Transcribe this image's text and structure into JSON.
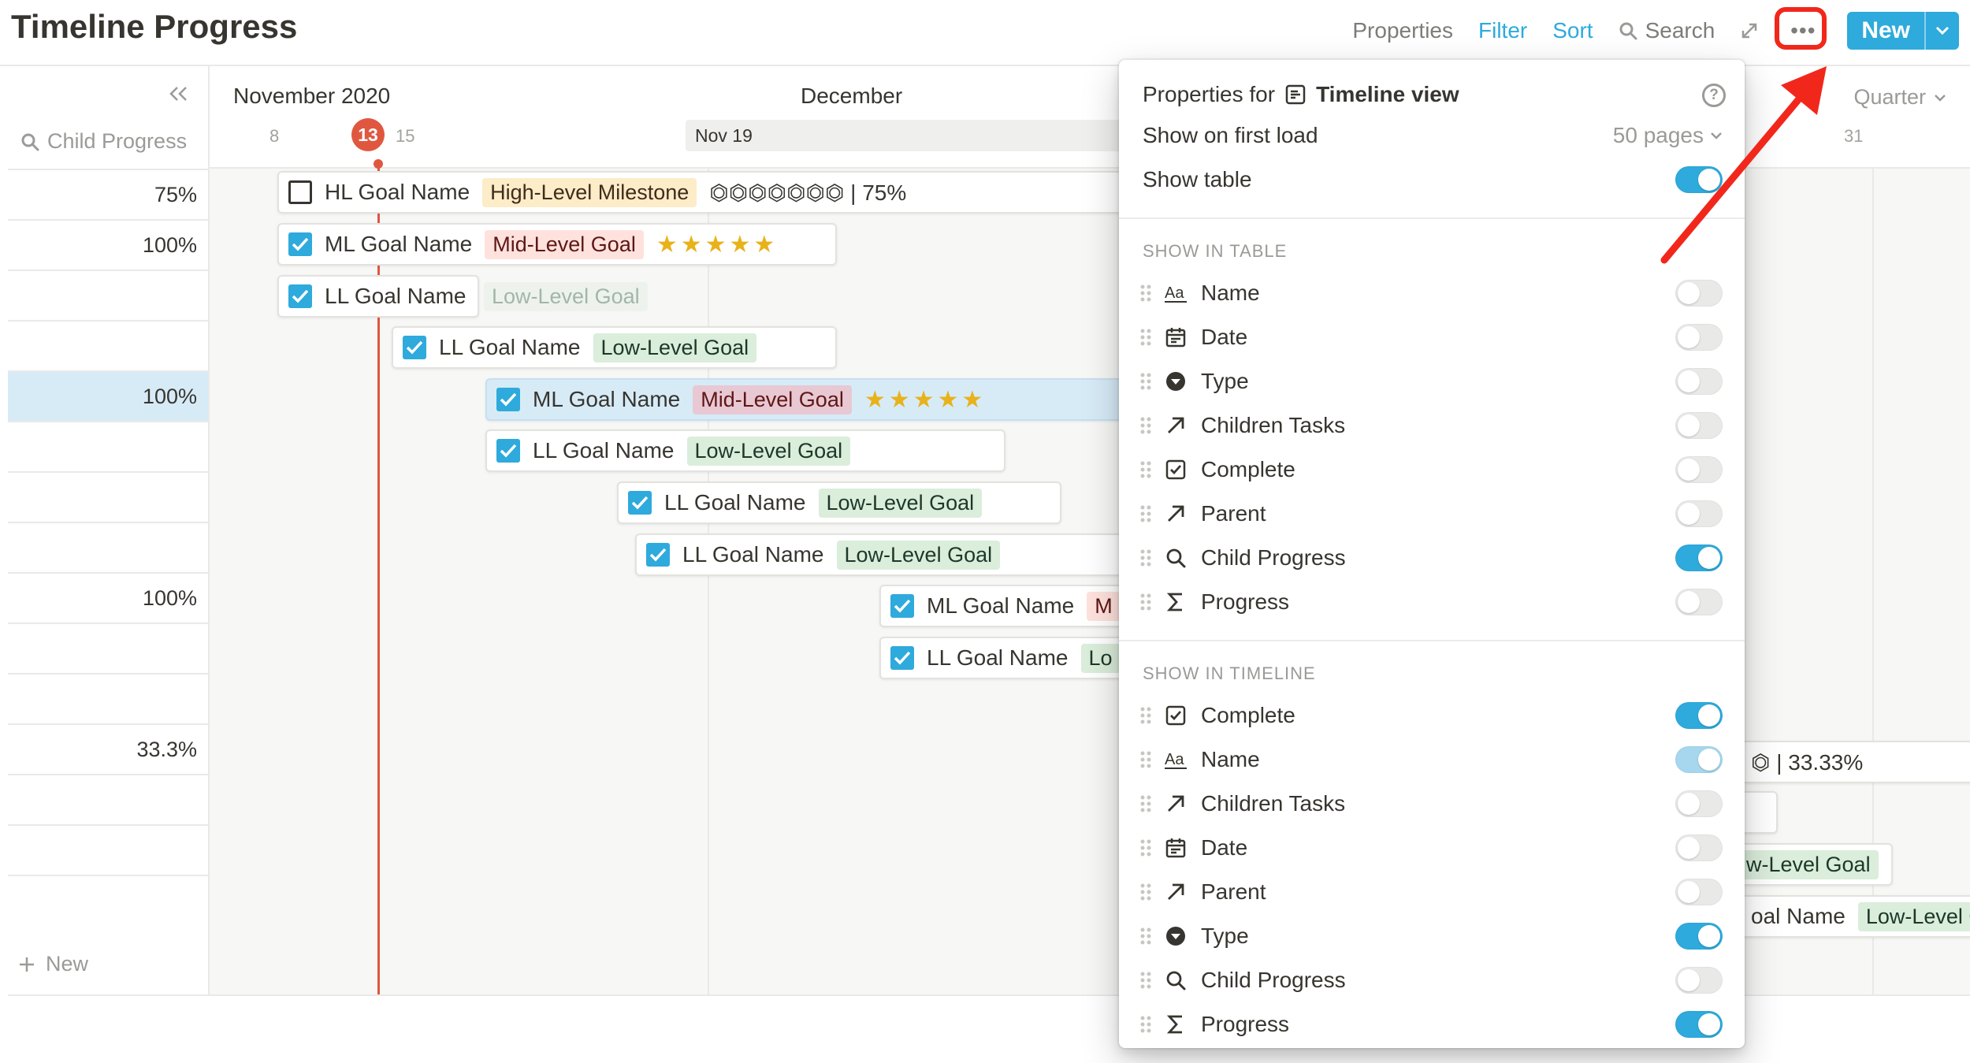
{
  "page": {
    "title": "Timeline Progress"
  },
  "toolbar": {
    "properties": "Properties",
    "filter": "Filter",
    "sort": "Sort",
    "search": "Search",
    "more": "•••",
    "new": "New"
  },
  "left_pane": {
    "column_header": "Child Progress",
    "rows": [
      "75%",
      "100%",
      "",
      "",
      "100%",
      "",
      "",
      "",
      "100%",
      "",
      "",
      "33.3%",
      "",
      "",
      ""
    ],
    "new_label": "New"
  },
  "timeline_header": {
    "month_1": "November 2020",
    "month_2": "December",
    "day_8": "8",
    "today": "13",
    "day_15": "15",
    "day_31": "31",
    "range_label": "Nov 19",
    "zoom": "Quarter"
  },
  "cards": [
    {
      "checked": false,
      "name": "HL Goal Name",
      "tag": "High-Level Milestone",
      "progress": "⏣⏣⏣⏣⏣⏣⏣ | 75%"
    },
    {
      "checked": true,
      "name": "ML Goal Name",
      "tag": "Mid-Level Goal",
      "stars": "★★★★★"
    },
    {
      "checked": true,
      "name": "LL Goal Name",
      "tag": "Low-Level Goal"
    },
    {
      "checked": true,
      "name": "LL Goal Name",
      "tag": "Low-Level Goal"
    },
    {
      "checked": true,
      "name": "ML Goal Name",
      "tag": "Mid-Level Goal",
      "stars": "★★★★★"
    },
    {
      "checked": true,
      "name": "LL Goal Name",
      "tag": "Low-Level Goal"
    },
    {
      "checked": true,
      "name": "LL Goal Name",
      "tag": "Low-Level Goal"
    },
    {
      "checked": true,
      "name": "LL Goal Name",
      "tag": "Low-Level Goal"
    },
    {
      "checked": true,
      "name": "ML Goal Name",
      "tag": "M"
    },
    {
      "checked": true,
      "name": "LL Goal Name",
      "tag": "Lo"
    }
  ],
  "right_peek": {
    "progress": "⏣ | 33.33%",
    "tag_fragment": "w-Level Goal",
    "name_fragment": "oal Name",
    "tag_fragment_2": "Low-Level G"
  },
  "properties_panel": {
    "title_prefix": "Properties for",
    "view_name": "Timeline view",
    "show_first_load_label": "Show on first load",
    "show_first_load_value": "50 pages",
    "show_table_label": "Show table",
    "show_table_on": true,
    "table_section": "SHOW IN TABLE",
    "table_props": [
      {
        "label": "Name",
        "icon": "text-icon",
        "on": false
      },
      {
        "label": "Date",
        "icon": "calendar-icon",
        "on": false
      },
      {
        "label": "Type",
        "icon": "select-icon",
        "on": false
      },
      {
        "label": "Children Tasks",
        "icon": "relation-icon",
        "on": false
      },
      {
        "label": "Complete",
        "icon": "checkbox-icon",
        "on": false
      },
      {
        "label": "Parent",
        "icon": "relation-icon",
        "on": false
      },
      {
        "label": "Child Progress",
        "icon": "rollup-icon",
        "on": true
      },
      {
        "label": "Progress",
        "icon": "formula-icon",
        "on": false
      }
    ],
    "timeline_section": "SHOW IN TIMELINE",
    "timeline_props": [
      {
        "label": "Complete",
        "icon": "checkbox-icon",
        "on": true
      },
      {
        "label": "Name",
        "icon": "text-icon",
        "on": true
      },
      {
        "label": "Children Tasks",
        "icon": "relation-icon",
        "on": false
      },
      {
        "label": "Date",
        "icon": "calendar-icon",
        "on": false
      },
      {
        "label": "Parent",
        "icon": "relation-icon",
        "on": false
      },
      {
        "label": "Type",
        "icon": "select-icon",
        "on": true
      },
      {
        "label": "Child Progress",
        "icon": "rollup-icon",
        "on": false
      },
      {
        "label": "Progress",
        "icon": "formula-icon",
        "on": true
      }
    ]
  },
  "colors": {
    "accent": "#2eaadc",
    "today": "#e0573f",
    "callout": "#f2271c"
  }
}
